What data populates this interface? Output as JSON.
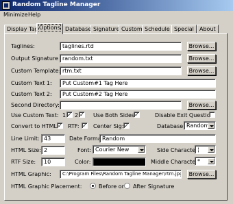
{
  "window": {
    "title": "Random Tagline Manager"
  },
  "menu": {
    "items": [
      "Minimize",
      "Help"
    ]
  },
  "tabs": [
    "Display Tag",
    "Options",
    "Database",
    "Signature",
    "Custom",
    "Schedule",
    "Special",
    "About"
  ],
  "active_tab": "Options",
  "options": {
    "taglines_label": "Taglines:",
    "taglines_value": "taglines.rtd",
    "output_signature_label": "Output Signature :",
    "output_signature_value": "random.txt",
    "custom_template_label": "Custom Template:",
    "custom_template_value": "rtm.txt",
    "custom_text1_label": "Custom Text 1:",
    "custom_text1_value": "Put Custom#1 Tag Here",
    "custom_text2_label": "Custom Text 2:",
    "custom_text2_value": "Put Custom#2 Tag Here",
    "second_directory_label": "Second Directory:",
    "second_directory_value": "",
    "browse_label": "Browse...",
    "use_custom_text_label": "Use Custom Text:",
    "custom_text_cb1_label": "1",
    "custom_text_cb2_label": "2",
    "check_mark": "✓",
    "use_both_sides_label": "Use Both Sides:",
    "disable_exit_question_label": "Disable Exit Question:",
    "convert_to_html_label": "Convert to HTML:",
    "rtf_label": "RTF:",
    "center_sig_label": "Center Sig:",
    "database_label": "Database:",
    "database_value": "Random",
    "line_limit_label": "Line Limit:",
    "line_limit_value": "43",
    "date_format_label": "Date Format:",
    "date_format_value": "Random",
    "html_size_label": "HTML Size:",
    "html_size_value": "2",
    "font_label": "Font:",
    "font_value": "Courier New",
    "side_character_label": "Side Character:",
    "side_character_value": "¦",
    "rtf_size_label": "RTF Size:",
    "rtf_size_value": "10",
    "color_label": "Color:",
    "color_value": "#000000",
    "middle_character_label": "Middle Character:",
    "middle_character_value": "*",
    "html_graphic_label": "HTML Graphic:",
    "html_graphic_value": "C:\\Program Files\\Random Tagline Manager\\rtm.jpg",
    "html_graphic_placement_label": "HTML Graphic Placement:",
    "placement_before_label": "Before or",
    "placement_after_label": "After Signature",
    "placement_selected": "before"
  }
}
